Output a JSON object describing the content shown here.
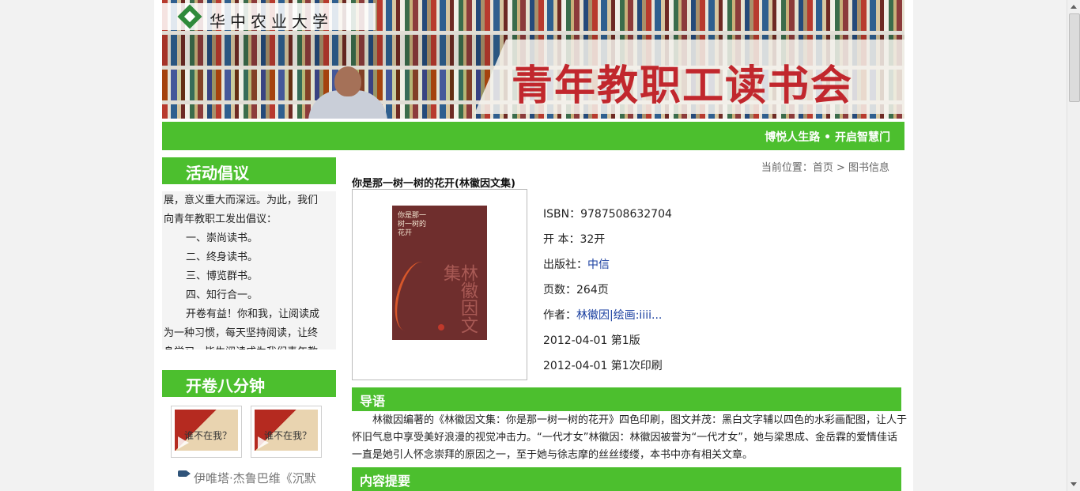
{
  "header": {
    "university_name": "华中农业大学",
    "banner_title": "青年教职工读书会",
    "slogan": "博悦人生路 • 开启智慧门"
  },
  "sidebar": {
    "activity_title": "活动倡议",
    "activity_lines": [
      "展，意义重大而深远。为此，我们",
      "向青年教职工发出倡议：",
      "一、崇尚读书。",
      "二、终身读书。",
      "三、博览群书。",
      "四、知行合一。",
      "开卷有益！你和我，让阅读成",
      "为一种习惯，每天坚持阅读，让终",
      "身学习、毕生阅读成为我们青年教"
    ],
    "video_title": "开卷八分钟",
    "video_thumb_caption": "谁不在我？",
    "video_link": "伊唯塔·杰鲁巴维《沉默"
  },
  "breadcrumb": "当前位置：首页 > 图书信息",
  "book": {
    "title": "你是那一树一树的花开(林徽因文集)",
    "cover_title": "你是那一树一树的花开",
    "cover_author": "林徽因文集",
    "isbn": "ISBN：9787508632704",
    "format": "开 本：32开",
    "publisher_label": "出版社：",
    "publisher": "中信",
    "pages": "页数：264页",
    "author_label": "作者：",
    "author": "林徽因|绘画:iiii...",
    "edition": "2012-04-01 第1版",
    "printing": "2012-04-01 第1次印刷"
  },
  "sections": {
    "intro_title": "导语",
    "intro_text": "林徽因编著的《林徽因文集：你是那一树一树的花开》四色印刷，图文并茂：黑白文字辅以四色的水彩画配图，让人于怀旧气息中享受美好浪漫的视觉冲击力。“一代才女”林徽因：林徽因被誉为“一代才女”，她与梁思成、金岳霖的爱情佳话一直是她引人怀念崇拜的原因之一，至于她与徐志摩的丝丝缕缕，本书中亦有相关文章。",
    "summary_title": "内容提要"
  },
  "colors": {
    "accent_green": "#4cbf2e",
    "banner_red": "#c1272d",
    "link_blue": "#1a3fa0"
  }
}
